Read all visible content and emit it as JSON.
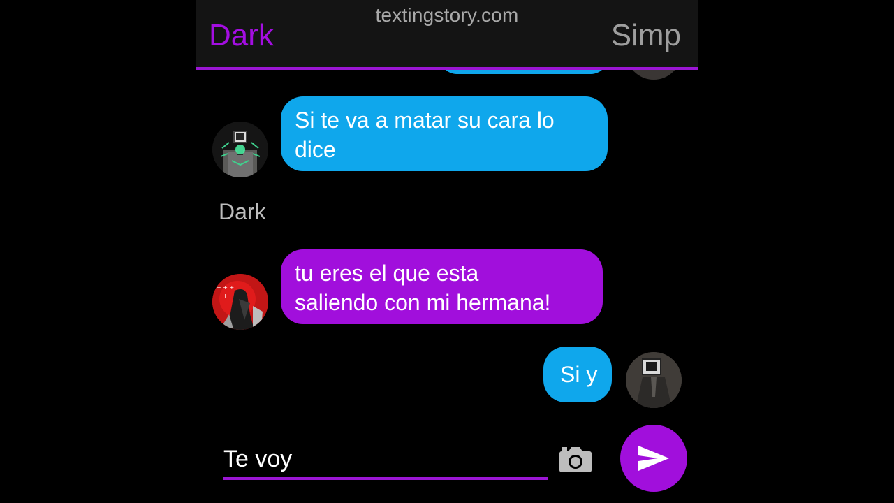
{
  "header": {
    "watermark": "textingstory.com",
    "left_contact": "Dark",
    "right_contact": "Simp"
  },
  "messages": [
    {
      "text": "Si te va a matar su cara lo dice",
      "line1": "Si te va a matar su cara lo",
      "line2": "dice",
      "side": "left",
      "color": "#0fa7ec"
    },
    {
      "sender_label": "Dark"
    },
    {
      "text": "tu eres el que esta saliendo con mi hermana!",
      "line1": "tu eres el que esta",
      "line2": "saliendo con mi hermana!",
      "side": "left",
      "color": "#a10fdc"
    },
    {
      "text": "Si y",
      "side": "right",
      "color": "#0fa7ec"
    }
  ],
  "composer": {
    "value": "Te voy"
  },
  "icons": {
    "camera": "camera-icon",
    "send": "send-icon"
  },
  "colors": {
    "accent": "#9b16d4",
    "blue_bubble": "#0fa7ec",
    "purple_bubble": "#a10fdc",
    "background": "#000000"
  }
}
